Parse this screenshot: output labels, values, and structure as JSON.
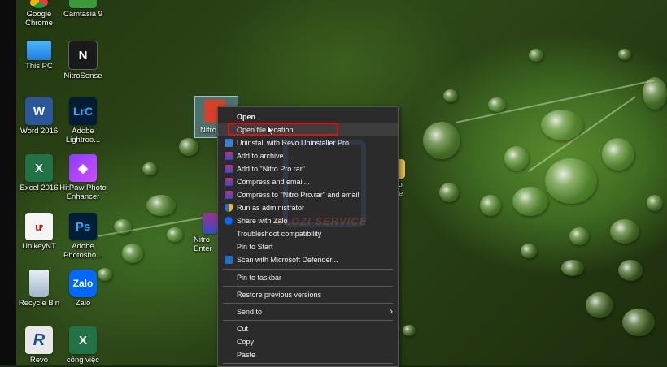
{
  "desktop": {
    "icons": [
      {
        "label": "Google\nChrome"
      },
      {
        "label": "Camtasia 9"
      },
      {
        "label": "This PC"
      },
      {
        "label": "NitroSense"
      },
      {
        "label": "Word 2016",
        "glyph": "W"
      },
      {
        "label": "Adobe\nLightroo...",
        "glyph": "LrC"
      },
      {
        "label": "Excel 2016",
        "glyph": "X"
      },
      {
        "label": "HitPaw Photo\nEnhancer"
      },
      {
        "label": "UnikeyNT",
        "glyph": "ư"
      },
      {
        "label": "Adobe\nPhotosho...",
        "glyph": "Ps"
      },
      {
        "label": "Recycle Bin"
      },
      {
        "label": "Zalo",
        "glyph": "Zalo"
      },
      {
        "label": "Revo",
        "glyph": "R"
      },
      {
        "label": "công việc",
        "glyph": "X"
      },
      {
        "label": "Nitro"
      },
      {
        "label": "Nitro\nEnter"
      },
      {
        "label": "Pro\nrise"
      }
    ],
    "watermark": "OLOZI SERVICE"
  },
  "context_menu": {
    "items": [
      {
        "label": "Open",
        "icon": "none"
      },
      {
        "label": "Open file location",
        "icon": "none"
      },
      {
        "label": "Uninstall with Revo Uninstaller Pro",
        "icon": "revo-icon"
      },
      {
        "label": "Add to archive...",
        "icon": "winrar-icon"
      },
      {
        "label": "Add to \"Nitro Pro.rar\"",
        "icon": "winrar-icon"
      },
      {
        "label": "Compress and email...",
        "icon": "winrar-icon"
      },
      {
        "label": "Compress to \"Nitro Pro.rar\" and email",
        "icon": "winrar-icon"
      },
      {
        "label": "Run as administrator",
        "icon": "shield-icon"
      },
      {
        "label": "Share with Zalo",
        "icon": "zalo-icon"
      },
      {
        "label": "Troubleshoot compatibility",
        "icon": "none"
      },
      {
        "label": "Pin to Start",
        "icon": "none"
      },
      {
        "label": "Scan with Microsoft Defender...",
        "icon": "defender-icon"
      },
      {
        "label": "Pin to taskbar",
        "icon": "none"
      },
      {
        "label": "Restore previous versions",
        "icon": "none"
      },
      {
        "label": "Send to",
        "icon": "none"
      },
      {
        "label": "Cut",
        "icon": "none"
      },
      {
        "label": "Copy",
        "icon": "none"
      },
      {
        "label": "Paste",
        "icon": "none"
      }
    ],
    "highlighted_item": "Open file location",
    "highlight_color": "#e01010"
  }
}
